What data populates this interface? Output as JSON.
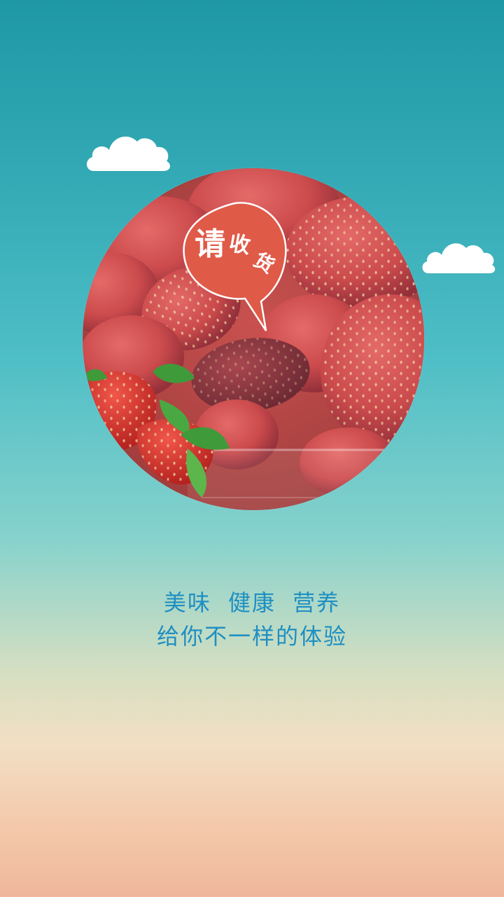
{
  "splash": {
    "badge_chars": [
      "请",
      "收",
      "货"
    ],
    "tagline_line1": "美味 健康 营养",
    "tagline_line2": "给你不一样的体验",
    "colors": {
      "sky_top": "#1f98a6",
      "sky_bottom": "#efb79b",
      "text": "#1f8fc2",
      "badge": "#e05a48"
    },
    "icons": [
      "cloud-icon",
      "strawberry-photo",
      "speech-bubble-badge"
    ]
  }
}
